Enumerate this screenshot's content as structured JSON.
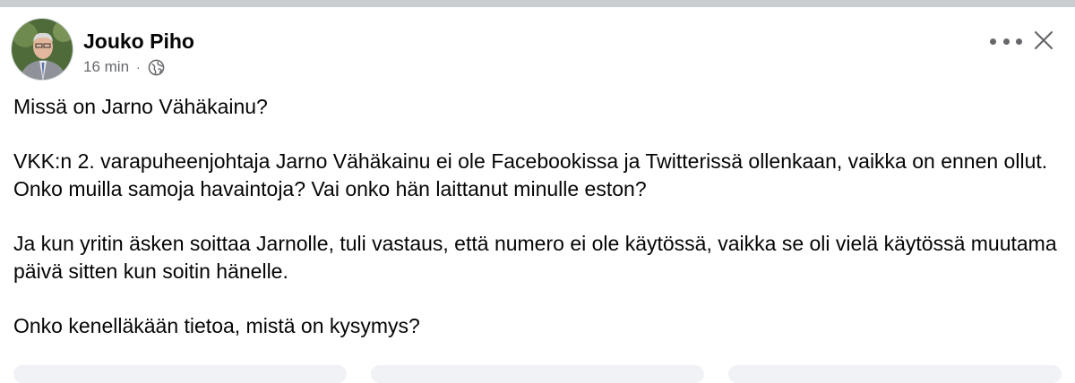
{
  "post": {
    "author": "Jouko Piho",
    "time": "16 min",
    "separator": "·",
    "privacy_icon": "globe-icon",
    "paragraphs": [
      "Missä on Jarno Vähäkainu?",
      "VKK:n 2. varapuheenjohtaja Jarno Vähäkainu ei ole Facebookissa ja Twitterissä ollenkaan, vaikka on ennen ollut. Onko muilla samoja havaintoja? Vai onko hän laittanut minulle eston?",
      "Ja kun yritin äsken soittaa Jarnolle, tuli vastaus, että numero ei ole käytössä, vaikka se oli vielä käytössä muutama päivä sitten kun soitin hänelle.",
      "Onko kenelläkään tietoa, mistä on kysymys?"
    ]
  },
  "header_icons": {
    "more": "more-options-icon",
    "close": "close-icon"
  },
  "colors": {
    "text": "#050505",
    "secondary": "#65676b",
    "topbar": "#c9ccd1",
    "button_bg": "#f0f2f5"
  }
}
